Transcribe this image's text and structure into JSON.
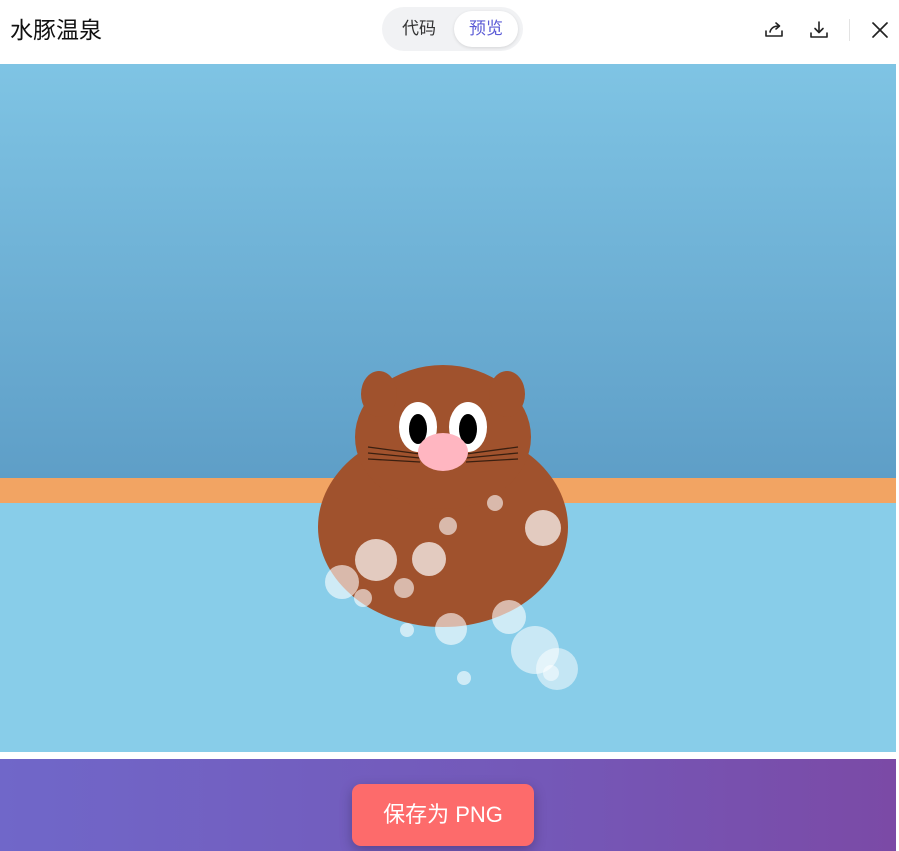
{
  "header": {
    "title": "水豚温泉",
    "tabs": [
      {
        "label": "代码",
        "active": false
      },
      {
        "label": "预览",
        "active": true
      }
    ],
    "icons": [
      "share-icon",
      "download-icon",
      "close-icon"
    ]
  },
  "preview": {
    "scene": "capybara-hot-spring",
    "colors": {
      "sky_top": "#7fc4e4",
      "sky_bottom": "#5e9ec7",
      "rim": "#f2a463",
      "water": "#88cde9",
      "capybara": "#a0522d",
      "nose": "#ffb6c1",
      "bubble": "#ffffff"
    }
  },
  "footer": {
    "save_label": "保存为 PNG",
    "gradient_start": "#7067c9",
    "gradient_end": "#7b4aa6",
    "button_color": "#fd6b6b"
  }
}
